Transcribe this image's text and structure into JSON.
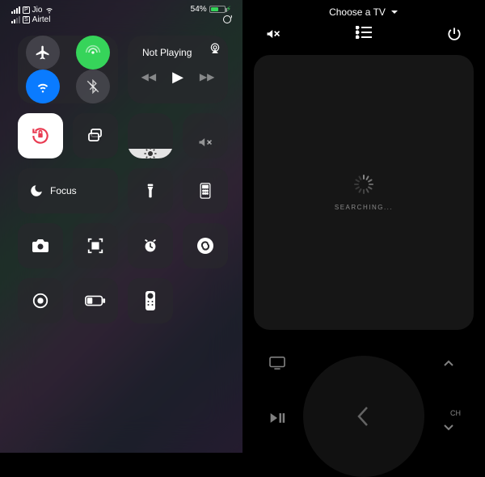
{
  "status": {
    "carrier1": "Jio",
    "carrier2": "Airtel",
    "sim1_badge": "P",
    "sim2_badge": "S",
    "battery_percent": "54%"
  },
  "control_center": {
    "now_playing_label": "Not Playing",
    "focus_label": "Focus"
  },
  "remote": {
    "header": "Choose a TV",
    "searching": "SEARCHING...",
    "ch_label": "CH"
  },
  "brightness_level_pct": 22,
  "volume_muted": true
}
